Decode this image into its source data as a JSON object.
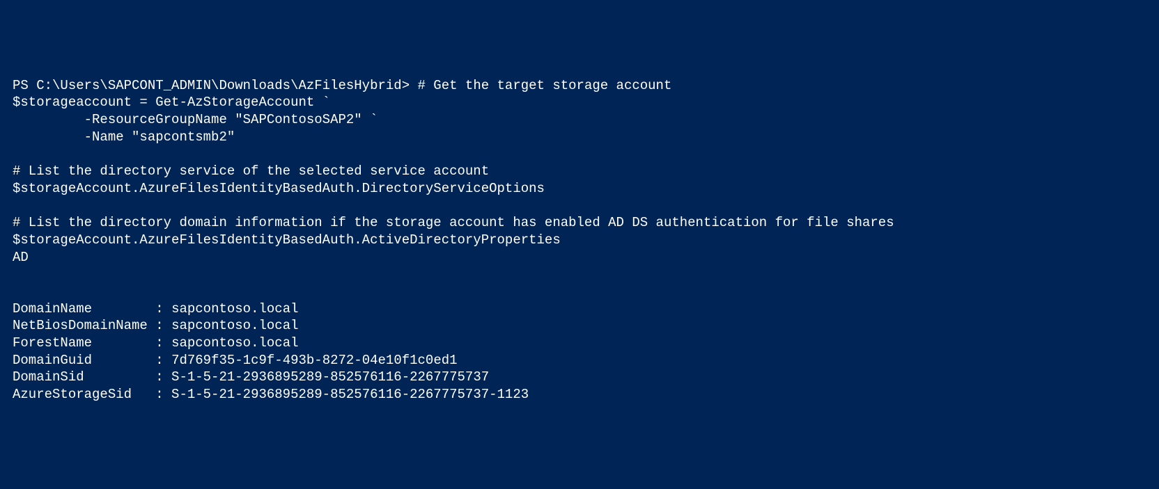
{
  "terminal": {
    "prompt": "PS C:\\Users\\SAPCONT_ADMIN\\Downloads\\AzFilesHybrid> ",
    "line1_comment": "# Get the target storage account",
    "line2": "$storageaccount = Get-AzStorageAccount `",
    "line3": "         -ResourceGroupName \"SAPContosoSAP2\" `",
    "line4": "         -Name \"sapcontsmb2\"",
    "line5": "",
    "line6": "# List the directory service of the selected service account",
    "line7": "$storageAccount.AzureFilesIdentityBasedAuth.DirectoryServiceOptions",
    "line8": "",
    "line9": "# List the directory domain information if the storage account has enabled AD DS authentication for file shares",
    "line10": "$storageAccount.AzureFilesIdentityBasedAuth.ActiveDirectoryProperties",
    "line11": "AD",
    "line12": "",
    "line13": "",
    "properties": [
      {
        "key": "DomainName",
        "value": "sapcontoso.local"
      },
      {
        "key": "NetBiosDomainName",
        "value": "sapcontoso.local"
      },
      {
        "key": "ForestName",
        "value": "sapcontoso.local"
      },
      {
        "key": "DomainGuid",
        "value": "7d769f35-1c9f-493b-8272-04e10f1c0ed1"
      },
      {
        "key": "DomainSid",
        "value": "S-1-5-21-2936895289-852576116-2267775737"
      },
      {
        "key": "AzureStorageSid",
        "value": "S-1-5-21-2936895289-852576116-2267775737-1123"
      }
    ]
  }
}
